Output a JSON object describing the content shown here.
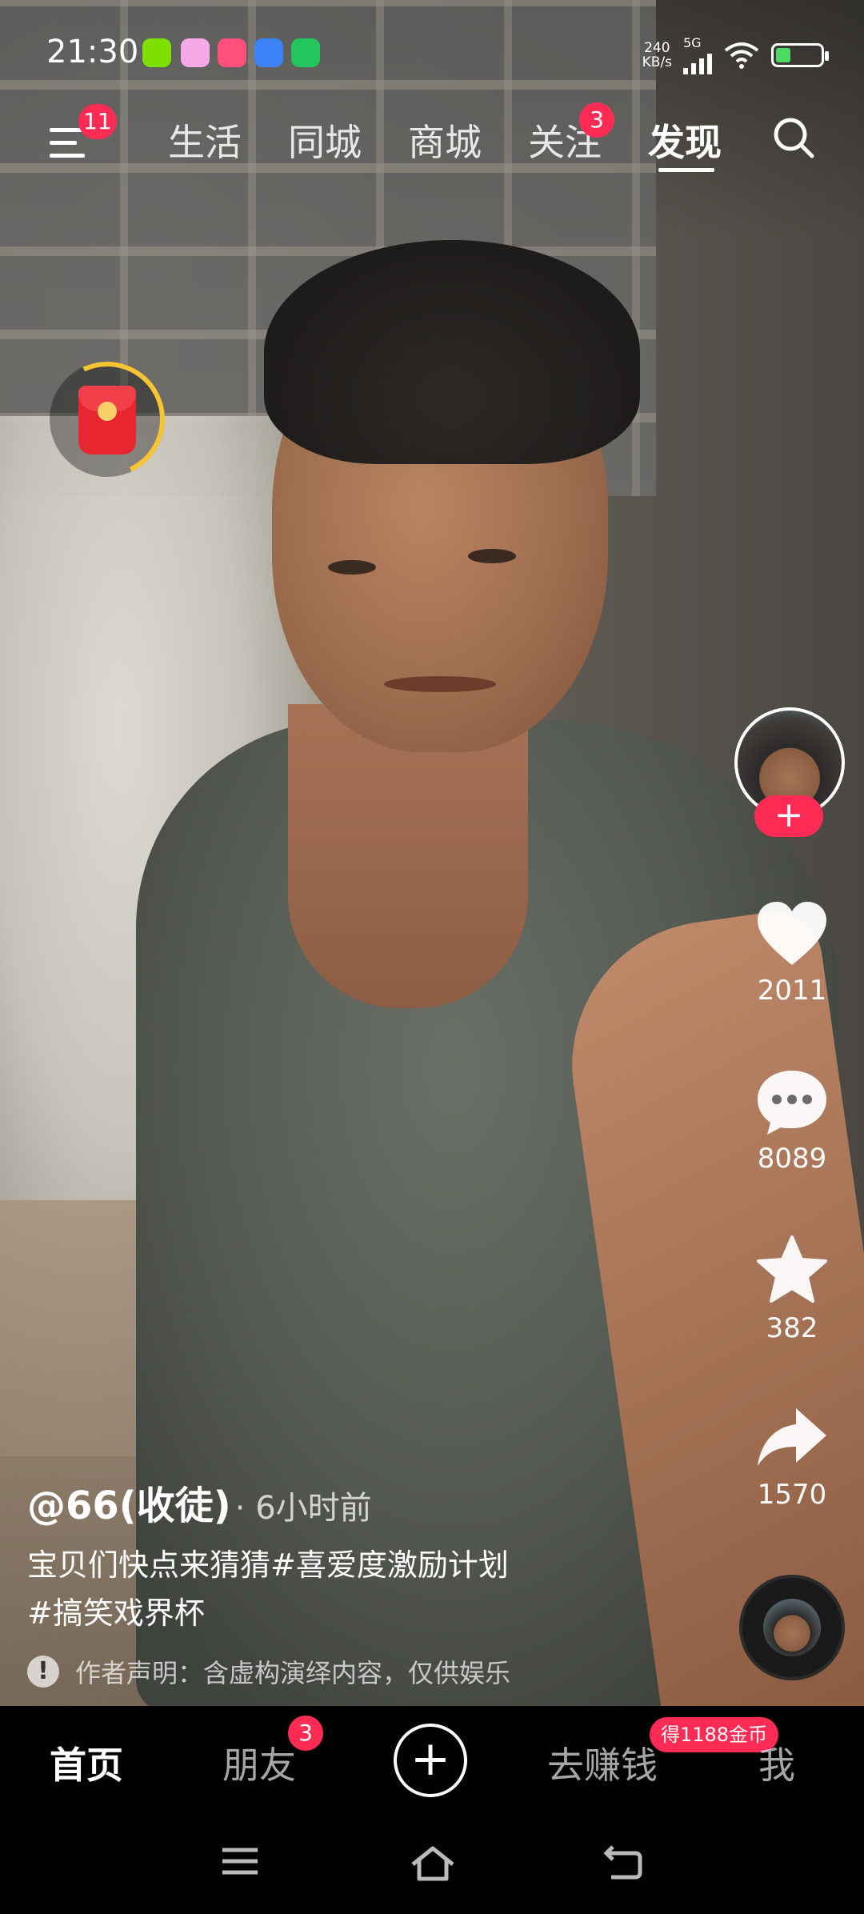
{
  "status_bar": {
    "time": "21:30",
    "net_speed_value": "240",
    "net_speed_unit": "KB/s",
    "network": "5G",
    "battery_percent": 25,
    "app_icon_colors": [
      "#7ee000",
      "#f7a8e8",
      "#ff4f7a",
      "#3b82f6",
      "#22c55e"
    ]
  },
  "top_nav": {
    "menu_badge": "11",
    "tabs": [
      {
        "label": "生活"
      },
      {
        "label": "同城"
      },
      {
        "label": "商城"
      },
      {
        "label": "关注",
        "badge": "3"
      },
      {
        "label": "发现",
        "active": true
      }
    ]
  },
  "actions": {
    "like_count": "2011",
    "comment_count": "8089",
    "favorite_count": "382",
    "share_count": "1570"
  },
  "video": {
    "author": "@66(收徒)",
    "time_ago": "· 6小时前",
    "description_line1": "宝贝们快点来猜猜#喜爱度激励计划",
    "description_line2": "#搞笑戏界杯",
    "disclaimer": "作者声明：含虚构演绎内容，仅供娱乐"
  },
  "bottom_nav": {
    "home": "首页",
    "friends": "朋友",
    "friends_badge": "3",
    "earn": "去赚钱",
    "earn_tag": "得1188金币",
    "me": "我"
  },
  "colors": {
    "accent": "#fe2c55",
    "battery": "#4cd964"
  }
}
